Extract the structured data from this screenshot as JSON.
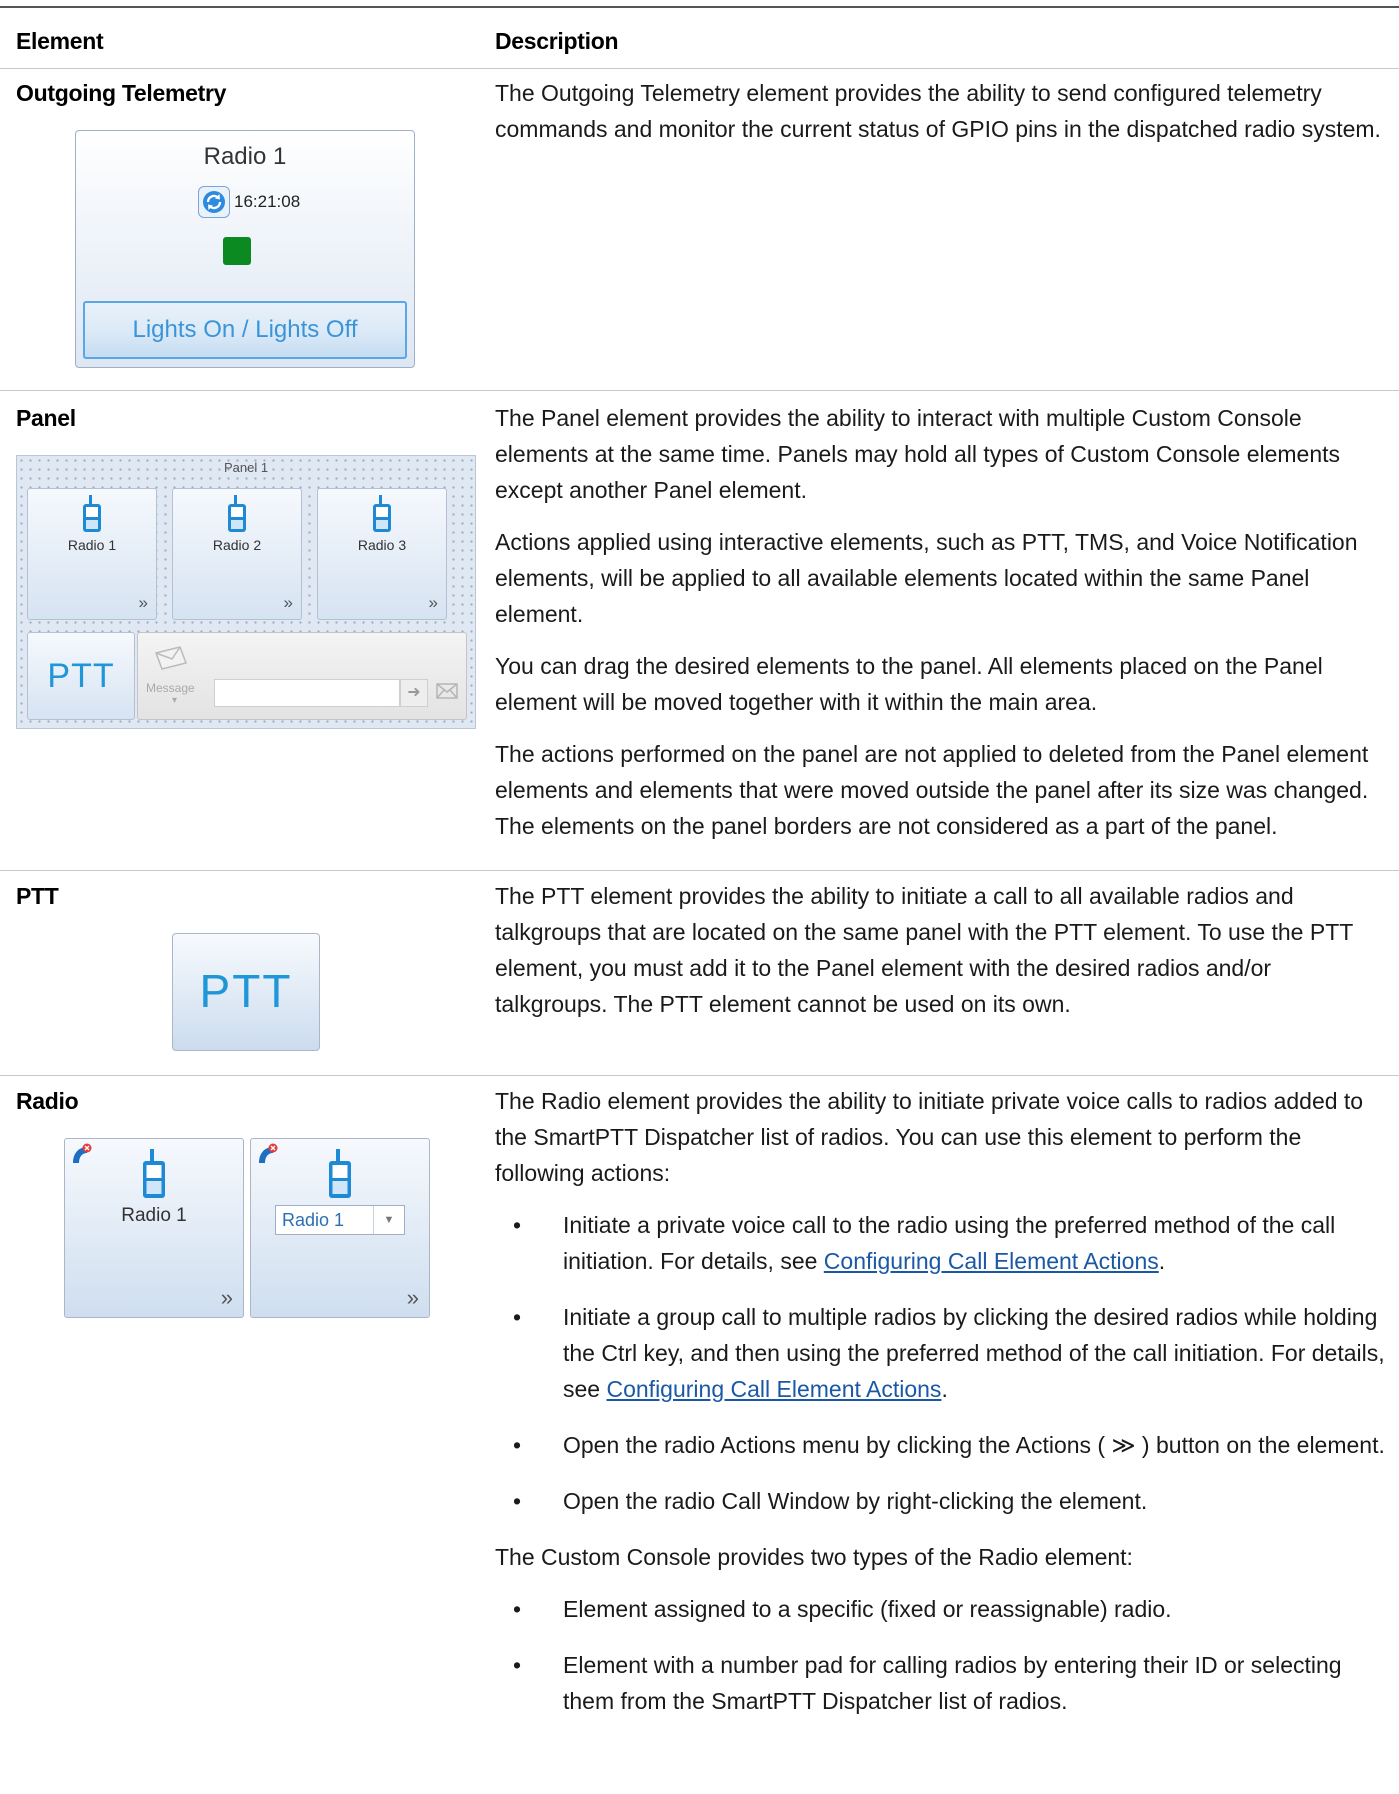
{
  "header": {
    "element": "Element",
    "description": "Description"
  },
  "rows": {
    "telemetry": {
      "title": "Outgoing Telemetry",
      "widget": {
        "radio_name": "Radio 1",
        "time": "16:21:08",
        "button_label": "Lights On / Lights Off",
        "status_color": "#0b8a22"
      },
      "desc": [
        "The Outgoing Telemetry element provides the ability to send configured telemetry commands and monitor the current status of GPIO pins in the dispatched radio system."
      ]
    },
    "panel": {
      "title": "Panel",
      "widget": {
        "panel_title": "Panel 1",
        "radios": [
          "Radio 1",
          "Radio 2",
          "Radio 3"
        ],
        "ptt_label": "PTT",
        "message_label": "Message"
      },
      "desc": [
        "The Panel element provides the ability to interact with multiple Custom Console elements at the same time. Panels may hold all types of Custom Console elements except another Panel element.",
        "Actions applied using interactive elements, such as PTT, TMS, and Voice Notification elements, will be applied to all available elements located within the same Panel element.",
        "You can drag the desired elements to the panel. All elements placed on the Panel element will be moved together with it within the main area.",
        "The actions performed on the panel are not applied to deleted from the Panel element elements and elements that were moved outside the panel after its size was changed. The elements on the panel borders are not considered as a part of the panel."
      ]
    },
    "ptt": {
      "title": "PTT",
      "widget": {
        "label": "PTT"
      },
      "desc": [
        "The PTT element provides the ability to initiate a call to all available radios and talkgroups that are located on the same panel with the PTT element. To use the PTT element, you must add it to the Panel element with the desired radios and/or talkgroups. The PTT element cannot be used on its own."
      ]
    },
    "radio": {
      "title": "Radio",
      "widget": {
        "fixed_label": "Radio 1",
        "select_value": "Radio 1"
      },
      "intro": "The Radio element provides the ability to initiate private voice calls to radios added to the SmartPTT Dispatcher list of radios. You can use this element to perform the following actions:",
      "bullet_char": "•",
      "b1_text": "Initiate a private voice call to the radio using the preferred method of the call initiation. For details, see ",
      "b1_link": "Configuring Call Element Actions",
      "b2_text": "Initiate a group call to multiple radios by clicking the desired radios while holding the Ctrl key, and then using the preferred method of the call initiation. For details, see ",
      "b2_link": "Configuring Call Element Actions",
      "b3_pre": "Open the radio Actions menu by clicking the Actions ( ",
      "b3_glyph": "≫",
      "b3_post": " ) button on the element.",
      "b4_text": "Open the radio Call Window by right-clicking the element.",
      "types_intro": "The Custom Console provides two types of the Radio element:",
      "t1_text": "Element assigned to a specific (fixed or reassignable) radio.",
      "t2_text": "Element with a number pad for calling radios by entering their ID or selecting them from the SmartPTT Dispatcher list of radios.",
      "period": "."
    }
  },
  "icons": {
    "actions": "»",
    "send": "➜"
  }
}
